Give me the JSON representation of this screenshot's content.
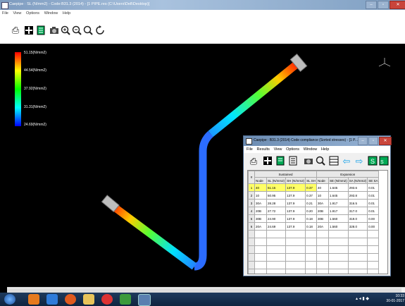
{
  "window": {
    "title": "Caepipe : SL (N/mm2) - Code:B31.3 (2014) - [1 PIPE.res (C:\\Users\\Dell\\Desktop)]"
  },
  "menu": [
    "File",
    "View",
    "Options",
    "Window",
    "Help"
  ],
  "toolbar_icons": [
    "print-icon",
    "chart-icon",
    "document-icon",
    "camera-icon",
    "zoom-in-icon",
    "zoom-out-icon",
    "zoom-fit-icon",
    "rotate-icon"
  ],
  "legend": [
    {
      "label": "51.15(N/mm2)",
      "color": "#ff0000"
    },
    {
      "label": "44.54(N/mm2)",
      "color": "#ffff00"
    },
    {
      "label": "37.92(N/mm2)",
      "color": "#00ff00"
    },
    {
      "label": "31.31(N/mm2)",
      "color": "#00ffff"
    },
    {
      "label": "24.69(N/mm2)",
      "color": "#0000ff"
    }
  ],
  "child_window": {
    "title": "Caepipe : B31.3 (2014) Code compliance (Sorted stresses) - [1 P...",
    "menu": [
      "File",
      "Results",
      "View",
      "Options",
      "Window",
      "Help"
    ],
    "group_headers": {
      "index": "#",
      "sustained": "Sustained",
      "expansion": "Expansion"
    },
    "columns": [
      "Node",
      "SL (N/mm2)",
      "SH (N/mm2)",
      "SL SH",
      "Node",
      "SE (N/mm2)",
      "SA (N/mm2)",
      "SE SA"
    ],
    "rows": [
      [
        "1",
        "40",
        "51.15",
        "137.9",
        "0.37",
        "40",
        "1.645",
        "293.6",
        "0.01"
      ],
      [
        "2",
        "10",
        "50.95",
        "137.9",
        "0.37",
        "10",
        "1.645",
        "293.8",
        "0.01"
      ],
      [
        "3",
        "30A",
        "28.28",
        "137.9",
        "0.21",
        "30A",
        "1.917",
        "316.5",
        "0.01"
      ],
      [
        "4",
        "20B",
        "27.72",
        "137.9",
        "0.20",
        "20B",
        "1.917",
        "317.0",
        "0.01"
      ],
      [
        "5",
        "30B",
        "24.90",
        "137.9",
        "0.18",
        "30B",
        "1.560",
        "319.0",
        "0.00"
      ],
      [
        "6",
        "20A",
        "24.69",
        "137.9",
        "0.18",
        "20A",
        "1.560",
        "328.0",
        "0.00"
      ]
    ]
  },
  "taskbar": {
    "time": "10:33",
    "date": "30-01-2017"
  },
  "colors": {
    "pipe_hot": "#ff0000",
    "pipe_cold": "#1f5fff",
    "highlight_row": "#ffff66"
  }
}
